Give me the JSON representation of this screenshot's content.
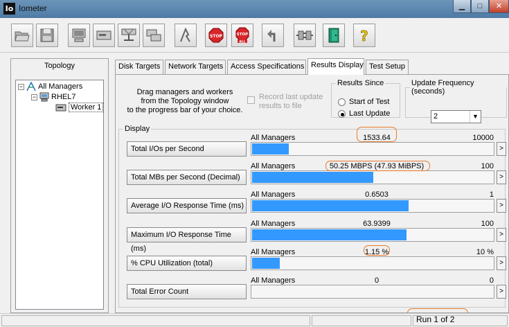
{
  "window": {
    "title": "Iometer",
    "app_icon_text": "Io"
  },
  "topology": {
    "title": "Topology",
    "tree": [
      {
        "label": "All Managers",
        "expander": "−"
      },
      {
        "label": "RHEL7",
        "expander": "−"
      },
      {
        "label": "Worker 1"
      }
    ]
  },
  "tabs": [
    {
      "label": "Disk Targets",
      "active": false
    },
    {
      "label": "Network Targets",
      "active": false
    },
    {
      "label": "Access Specifications",
      "active": false
    },
    {
      "label": "Results Display",
      "active": true
    },
    {
      "label": "Test Setup",
      "active": false
    }
  ],
  "results": {
    "drag_text_1": "Drag managers and workers",
    "drag_text_2": "from the Topology window",
    "drag_text_3": "to the progress bar of your choice.",
    "record_label_1": "Record last update",
    "record_label_2": "results to file",
    "record_checked": false,
    "since": {
      "legend": "Results Since",
      "option_start": "Start of Test",
      "option_last": "Last Update",
      "selected": "Last Update"
    },
    "frequency": {
      "legend": "Update Frequency (seconds)",
      "value": "2"
    },
    "display_legend": "Display",
    "rows": [
      {
        "label": "Total I/Os per Second",
        "target": "All Managers",
        "value": "1533.64",
        "max": "10000",
        "fill": 0.1534
      },
      {
        "label": "Total MBs per Second (Decimal)",
        "target": "All Managers",
        "value": "50.25 MBPS (47.93 MiBPS)",
        "max": "100",
        "fill": 0.5025
      },
      {
        "label": "Average I/O Response Time (ms)",
        "target": "All Managers",
        "value": "0.6503",
        "max": "1",
        "fill": 0.6503
      },
      {
        "label": "Maximum I/O Response Time (ms)",
        "target": "All Managers",
        "value": "63.9399",
        "max": "100",
        "fill": 0.6394
      },
      {
        "label": "% CPU Utilization (total)",
        "target": "All Managers",
        "value": "1.15 %",
        "max": "10 %",
        "fill": 0.115
      },
      {
        "label": "Total Error Count",
        "target": "All Managers",
        "value": "0",
        "max": "0",
        "fill": 0
      }
    ],
    "more_glyph": ">"
  },
  "status": {
    "run_text": "Run 1 of 2"
  },
  "colors": {
    "bar": "#3399ff",
    "highlight_oval": "#e87a2a"
  }
}
